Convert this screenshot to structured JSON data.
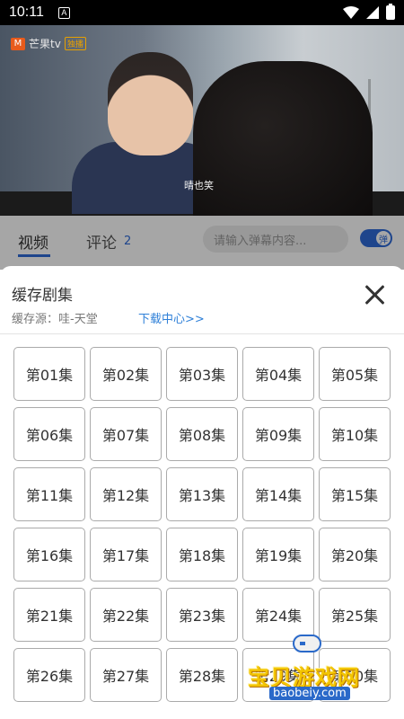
{
  "status_bar": {
    "time": "10:11",
    "notification": "A"
  },
  "video": {
    "logo": "芒果tv",
    "logo_tag": "独播",
    "subtitle": "晴也笑"
  },
  "tabs": {
    "video": "视频",
    "comment": "评论",
    "comment_count": "2"
  },
  "danmu": {
    "placeholder": "请输入弹幕内容...",
    "toggle_label": "弹"
  },
  "sheet": {
    "title": "缓存剧集",
    "source": "缓存源：哇-天堂",
    "download_center": "下载中心>>"
  },
  "episodes": [
    "第01集",
    "第02集",
    "第03集",
    "第04集",
    "第05集",
    "第06集",
    "第07集",
    "第08集",
    "第09集",
    "第10集",
    "第11集",
    "第12集",
    "第13集",
    "第14集",
    "第15集",
    "第16集",
    "第17集",
    "第18集",
    "第19集",
    "第20集",
    "第21集",
    "第22集",
    "第23集",
    "第24集",
    "第25集",
    "第26集",
    "第27集",
    "第28集",
    "第29集",
    "第30集"
  ],
  "watermark": {
    "text": "宝贝游戏网",
    "url": "baobeiy.com"
  },
  "colors": {
    "accent": "#2f6bd8",
    "link": "#2f80d8"
  }
}
